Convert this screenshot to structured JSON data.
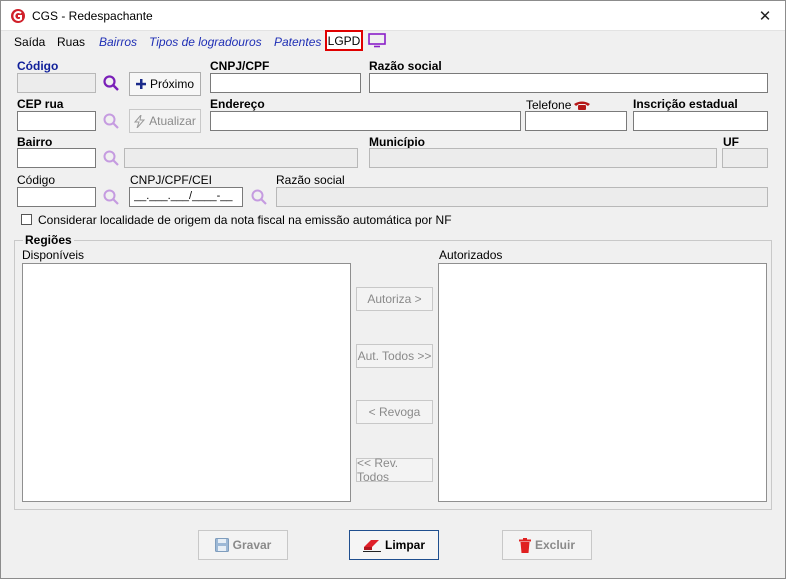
{
  "window": {
    "title": "CGS - Redespachante",
    "close_label": "✕"
  },
  "menu": {
    "saida": "Saída",
    "ruas": "Ruas",
    "bairros": "Bairros",
    "tipos_logradouros": "Tipos de logradouros",
    "patentes": "Patentes",
    "lgpd": "LGPD"
  },
  "form": {
    "codigo_label": "Código",
    "codigo_value": "",
    "proximo_label": "Próximo",
    "cnpj_cpf_label": "CNPJ/CPF",
    "cnpj_cpf_value": "",
    "razao_social_label": "Razão social",
    "razao_social_value": "",
    "cep_rua_label": "CEP rua",
    "cep_rua_value": "",
    "atualizar_label": "Atualizar",
    "endereco_label": "Endereço",
    "endereco_value": "",
    "telefone_label": "Telefone",
    "telefone_value": "",
    "inscricao_label": "Inscrição estadual",
    "inscricao_value": "",
    "bairro_label": "Bairro",
    "bairro_value": "",
    "bairro_nome_value": "",
    "municipio_label": "Município",
    "municipio_value": "",
    "uf_label": "UF",
    "uf_value": "",
    "codigo2_label": "Código",
    "codigo2_value": "",
    "cnpj_cpf_cei_label": "CNPJ/CPF/CEI",
    "cnpj_cpf_cei_value": "__.___.___/____-__",
    "razao_social2_label": "Razão social",
    "razao_social2_value": "",
    "considerar_label": "Considerar localidade de origem da nota fiscal na emissão automática por NF",
    "considerar_checked": false
  },
  "regioes": {
    "title": "Regiões",
    "disponiveis_label": "Disponíveis",
    "autorizados_label": "Autorizados",
    "disponiveis_items": [],
    "autorizados_items": [],
    "btn_autoriza": "Autoriza >",
    "btn_aut_todos": "Aut. Todos >>",
    "btn_revoga": "< Revoga",
    "btn_rev_todos": "<< Rev. Todos"
  },
  "footer": {
    "gravar": "Gravar",
    "limpar": "Limpar",
    "excluir": "Excluir"
  },
  "colors": {
    "accent_blue": "#10209a",
    "search_purple": "#7a1fb8",
    "lgpd_border": "#e00000",
    "limpar_icon": "#e0202a"
  },
  "icons": {
    "title": "app-logo-icon",
    "close": "close-icon",
    "monitor": "monitor-icon",
    "search": "search-icon",
    "plus": "plus-icon",
    "lightning": "lightning-icon",
    "phone": "phone-icon",
    "save": "floppy-icon",
    "eraser": "eraser-icon",
    "trash": "trash-icon"
  }
}
